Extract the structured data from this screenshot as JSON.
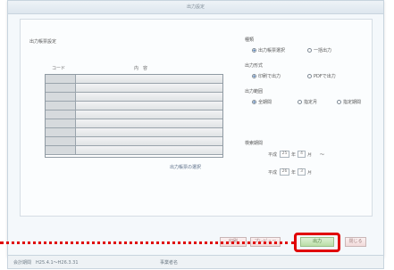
{
  "window": {
    "title": "出力設定"
  },
  "left_panel": {
    "section_title": "出力帳票設定",
    "col_no": "コード",
    "col_name": "内　容",
    "row_count": 9,
    "link_label": "出力帳票の選択"
  },
  "right_panel": {
    "group1": {
      "title": "種類",
      "options": [
        "出力帳票選択",
        "一括出力"
      ],
      "selected": 0
    },
    "group2": {
      "title": "出力形式",
      "options": [
        "印刷で出力",
        "PDFで出力"
      ],
      "selected": 0
    },
    "group3": {
      "title": "出力範囲",
      "options": [
        "全期間",
        "指定月",
        "指定期間"
      ],
      "selected": 0
    },
    "group4": {
      "title": "検索期間",
      "from": {
        "prefix": "平成",
        "year": "25",
        "y_unit": "年",
        "month": "4",
        "m_unit": "月",
        "suffix": "〜"
      },
      "to": {
        "prefix": "平成",
        "year": "26",
        "y_unit": "年",
        "month": "3",
        "m_unit": "月"
      }
    }
  },
  "footer": {
    "buttons": [
      "印刷",
      "プレビュー",
      "出力",
      "閉じる"
    ],
    "highlighted_button": "出力"
  },
  "statusbar": {
    "text1": "会計期間　H25.4.1〜H26.3.31",
    "text2": "事業者名"
  },
  "colors": {
    "highlight": "#e00000",
    "main_button": "#b9dea6"
  }
}
